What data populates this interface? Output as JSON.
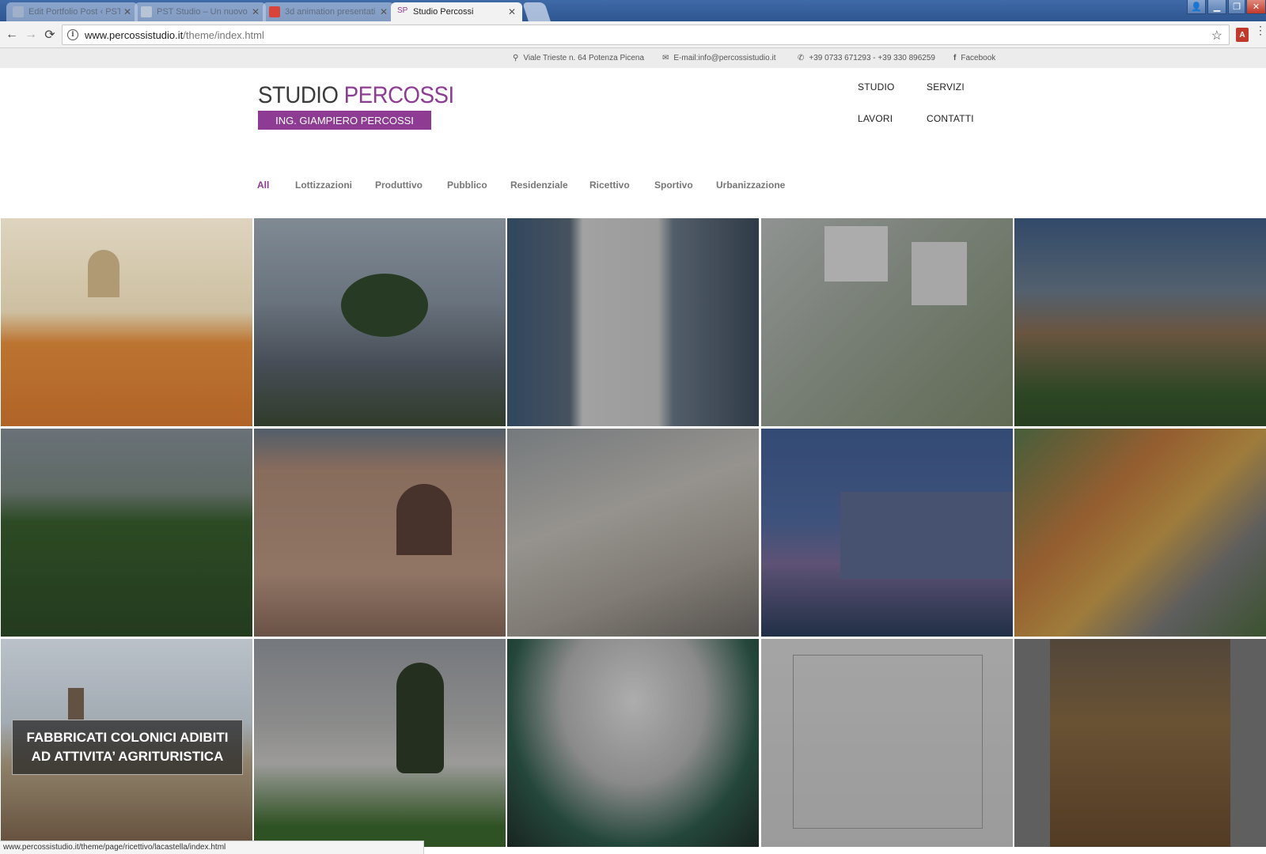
{
  "browser": {
    "tabs": [
      {
        "title": "Edit Portfolio Post ‹ PST",
        "active": false
      },
      {
        "title": "PST Studio – Un nuovo s",
        "active": false
      },
      {
        "title": "3d animation presentati",
        "active": false
      },
      {
        "title": "Studio Percossi",
        "active": true
      }
    ],
    "url_host": "www.percossistudio.it",
    "url_path": "/theme/index.html",
    "status_url": "www.percossistudio.it/theme/page/ricettivo/lacastella/index.html"
  },
  "infobar": {
    "address": "Viale Trieste n. 64 Potenza Picena",
    "email_label": "E-mail: ",
    "email": "info@percossistudio.it",
    "phone": "+39 0733 671293 - +39 330 896259",
    "facebook": "Facebook"
  },
  "logo": {
    "title_a": "STUDIO ",
    "title_b": "PERCOSSI",
    "subtitle": "ING. GIAMPIERO PERCOSSI"
  },
  "nav": {
    "studio": "STUDIO",
    "servizi": "SERVIZI",
    "lavori": "LAVORI",
    "contatti": "CONTATTI"
  },
  "filters": [
    "All",
    "Lottizzazioni",
    "Produttivo",
    "Pubblico",
    "Residenziale",
    "Ricettivo",
    "Sportivo",
    "Urbanizzazione"
  ],
  "gallery": {
    "caption": "FABBRICATI COLONICI ADIBITI AD ATTIVITA’ AGRITURISTICA"
  },
  "colors": {
    "accent": "#8e3b93"
  }
}
